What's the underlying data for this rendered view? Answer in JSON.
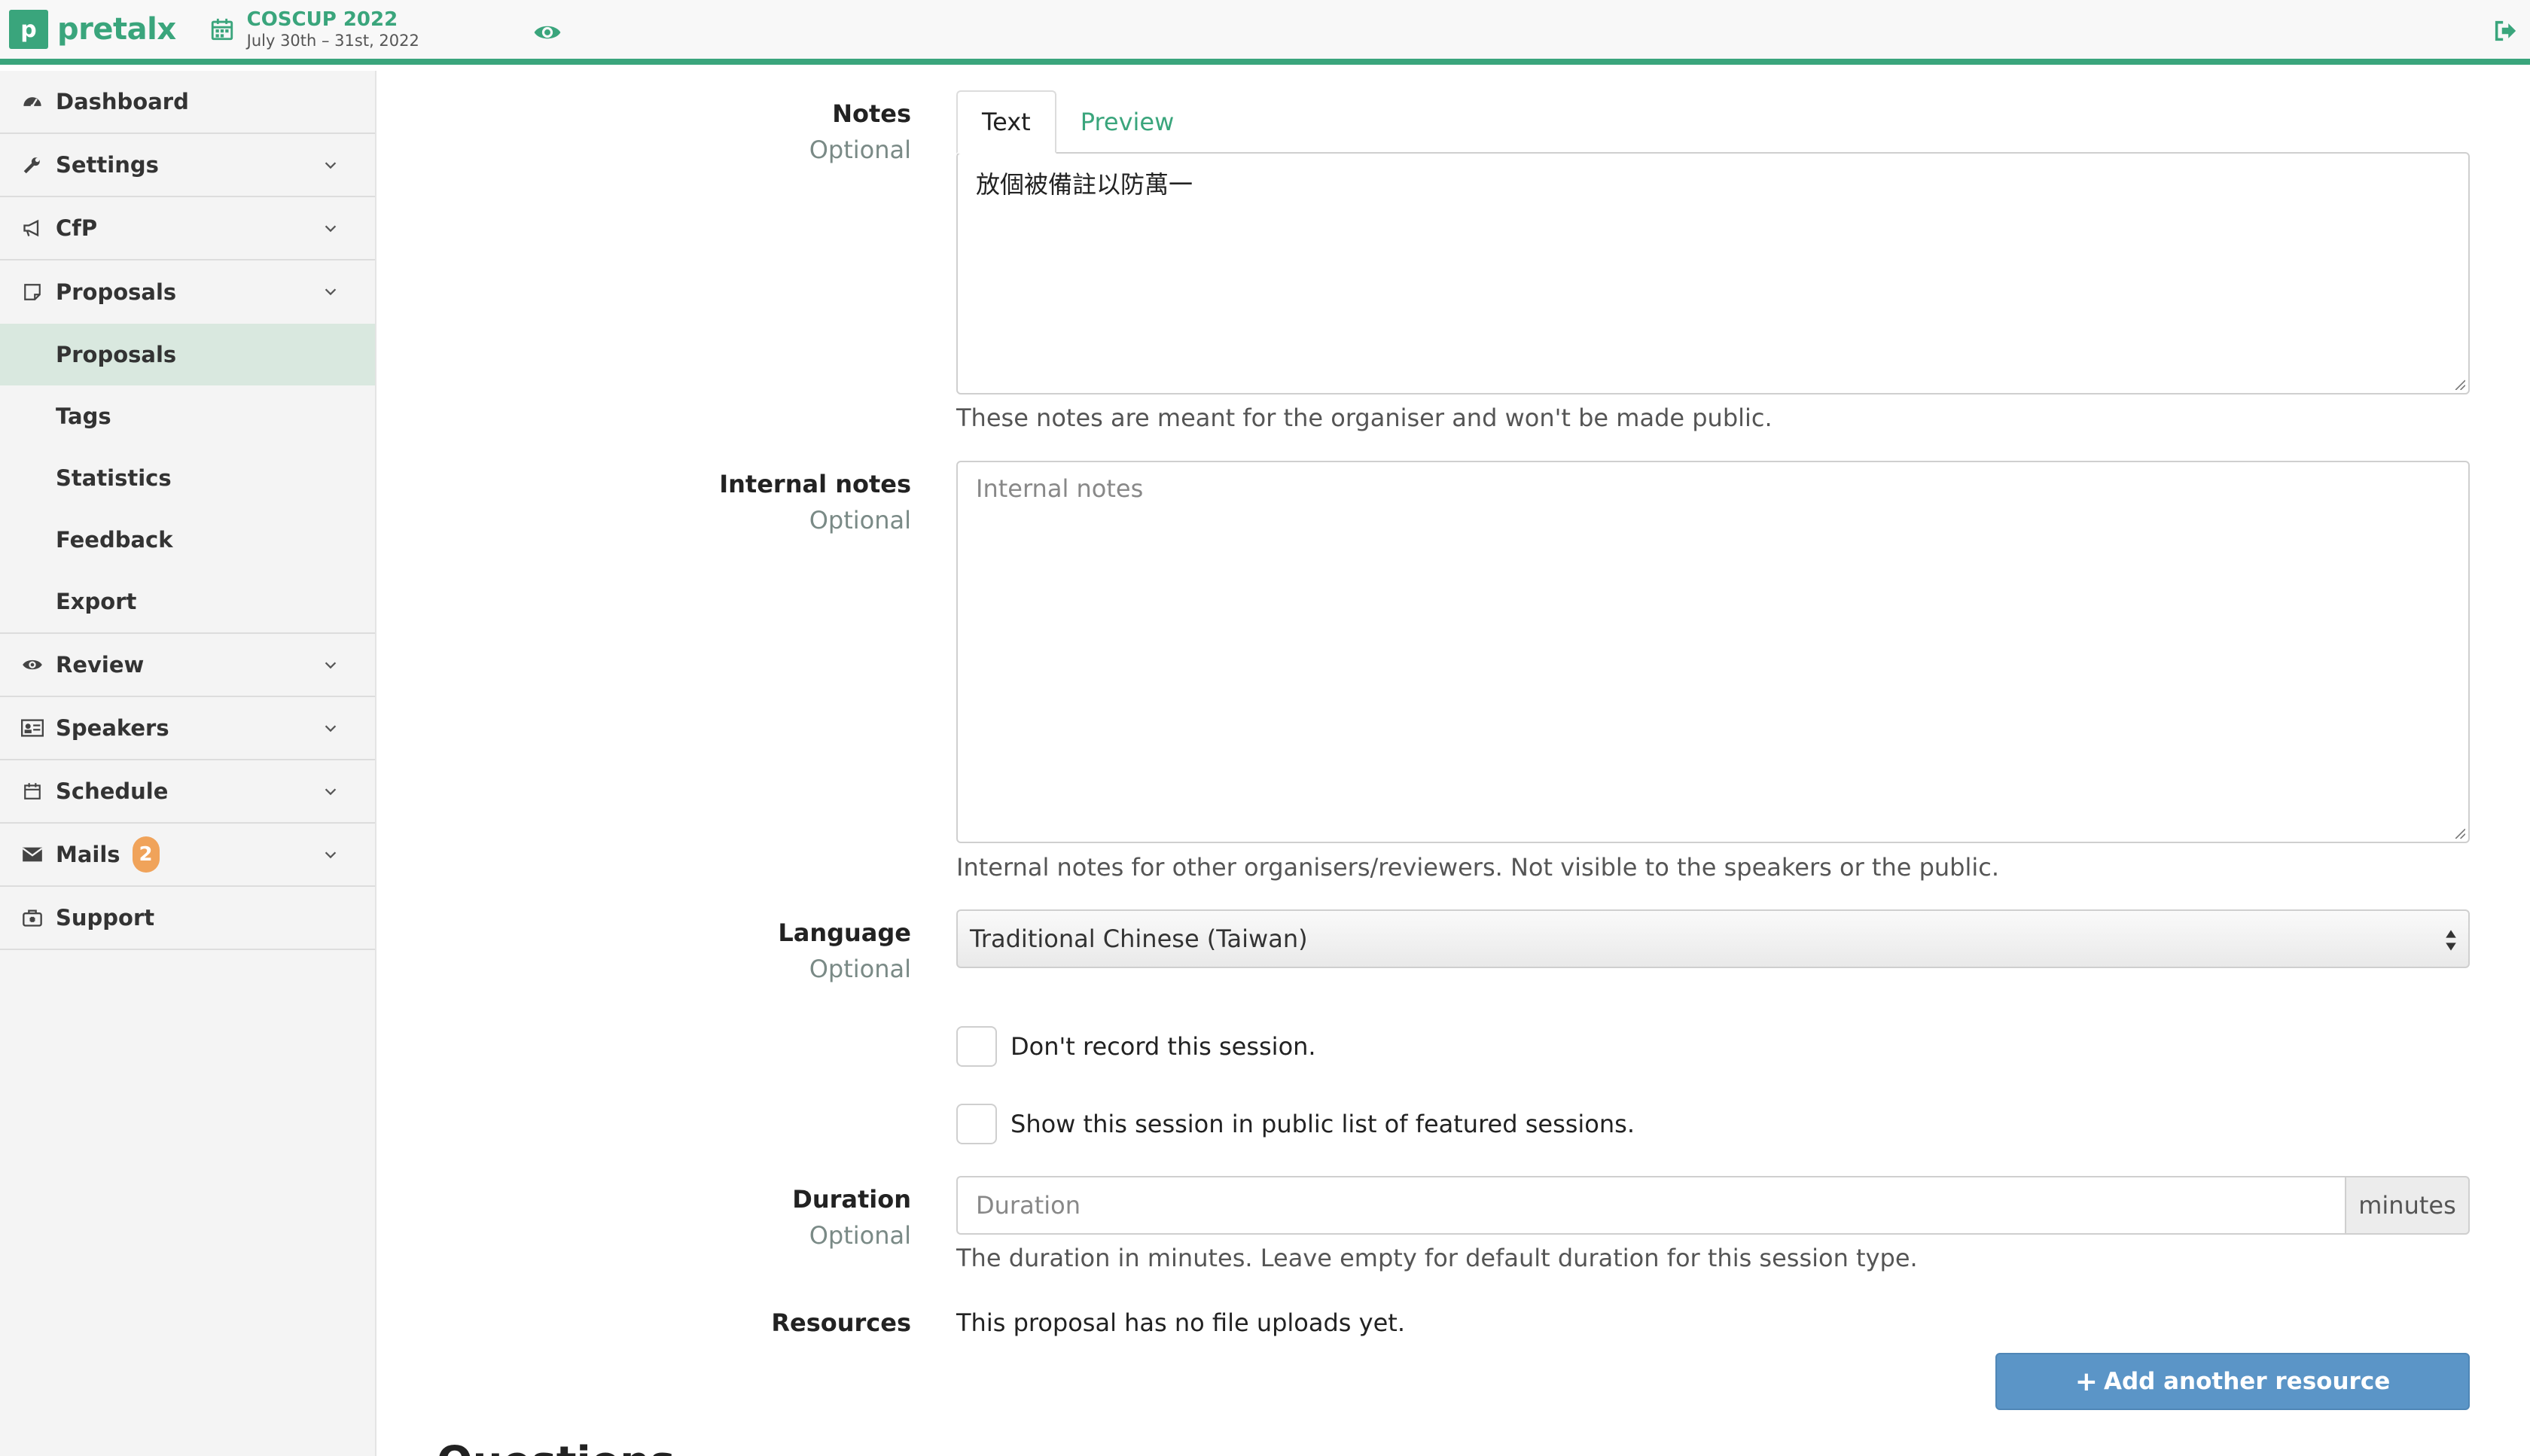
{
  "app": {
    "logo_letter": "p",
    "logo_name": "pretalx"
  },
  "event": {
    "name": "COSCUP 2022",
    "dates": "July 30th – 31st, 2022"
  },
  "sidebar": {
    "items": [
      {
        "label": "Dashboard",
        "icon": "dashboard-icon"
      },
      {
        "label": "Settings",
        "icon": "wrench-icon"
      },
      {
        "label": "CfP",
        "icon": "bullhorn-icon"
      },
      {
        "label": "Proposals",
        "icon": "note-icon"
      },
      {
        "label": "Review",
        "icon": "eye-icon"
      },
      {
        "label": "Speakers",
        "icon": "id-card-icon"
      },
      {
        "label": "Schedule",
        "icon": "calendar-icon"
      },
      {
        "label": "Mails",
        "icon": "envelope-icon",
        "badge": "2"
      },
      {
        "label": "Support",
        "icon": "life-ring-icon"
      }
    ],
    "proposals_sub": [
      "Proposals",
      "Tags",
      "Statistics",
      "Feedback",
      "Export"
    ]
  },
  "form": {
    "notes": {
      "label": "Notes",
      "optional": "Optional",
      "tab_text": "Text",
      "tab_preview": "Preview",
      "value": "放個被備註以防萬一",
      "help": "These notes are meant for the organiser and won't be made public."
    },
    "internal_notes": {
      "label": "Internal notes",
      "optional": "Optional",
      "placeholder": "Internal notes",
      "help": "Internal notes for other organisers/reviewers. Not visible to the speakers or the public."
    },
    "language": {
      "label": "Language",
      "optional": "Optional",
      "selected": "Traditional Chinese (Taiwan)"
    },
    "dont_record": "Don't record this session.",
    "featured": "Show this session in public list of featured sessions.",
    "duration": {
      "label": "Duration",
      "optional": "Optional",
      "placeholder": "Duration",
      "addon": "minutes",
      "help": "The duration in minutes. Leave empty for default duration for this session type."
    },
    "resources": {
      "label": "Resources",
      "text": "This proposal has no file uploads yet.",
      "button": "Add another resource"
    },
    "next_heading": "Questions"
  },
  "colors": {
    "brand": "#3aa57c",
    "button": "#5b95c7",
    "badge": "#f0a35a",
    "active_nav": "#d9e8df"
  }
}
